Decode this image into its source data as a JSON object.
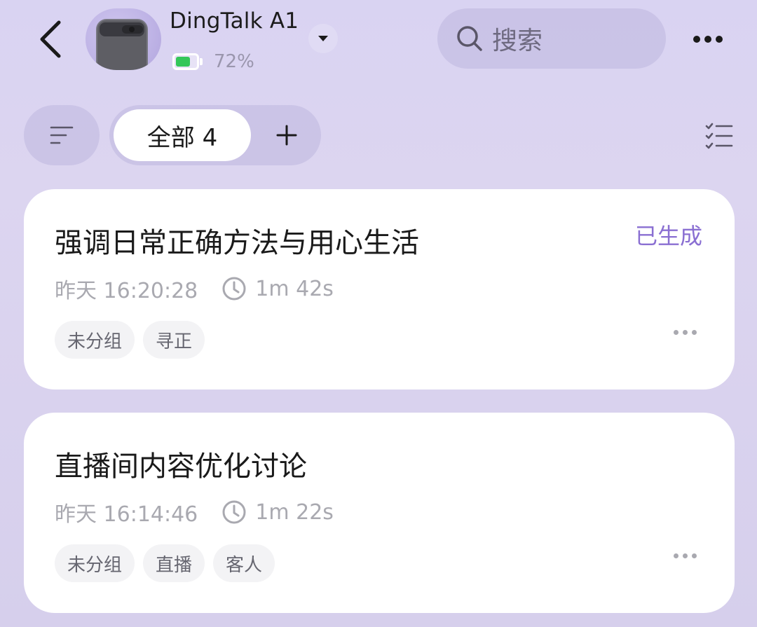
{
  "header": {
    "device_name": "DingTalk A1",
    "battery_percent_text": "72%",
    "battery_level": 0.72,
    "search_placeholder": "搜索"
  },
  "filter_bar": {
    "active_tab_label": "全部 4"
  },
  "colors": {
    "background": "#d9d3f2",
    "accent": "#8a6fd2",
    "battery": "#34c759",
    "card": "#ffffff",
    "tag_bg": "#f3f3f5",
    "meta_text": "#a9a9b0"
  },
  "icons": {
    "back": "chevron-left-icon",
    "caret": "caret-down-icon",
    "search": "search-icon",
    "more": "more-horizontal-icon",
    "sort": "sort-lines-icon",
    "add": "plus-icon",
    "select": "checklist-icon",
    "clock": "clock-icon"
  },
  "recordings": [
    {
      "title": "强调日常正确方法与用心生活",
      "status": "已生成",
      "time": "昨天 16:20:28",
      "duration": "1m 42s",
      "tags": [
        "未分组",
        "寻正"
      ]
    },
    {
      "title": "直播间内容优化讨论",
      "status": "",
      "time": "昨天 16:14:46",
      "duration": "1m 22s",
      "tags": [
        "未分组",
        "直播",
        "客人"
      ]
    }
  ]
}
